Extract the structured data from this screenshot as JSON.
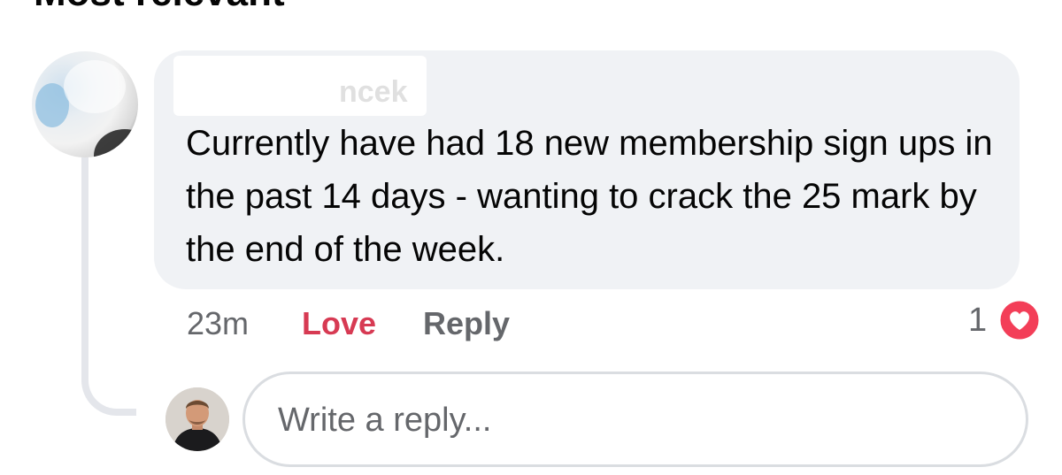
{
  "section": {
    "title": "Most relevant"
  },
  "comment": {
    "author_visible": "ncek",
    "text": "Currently have had 18 new membership sign ups in the past 14 days - wanting to crack the 25 mark by the end of the week.",
    "time": "23m",
    "love_label": "Love",
    "reply_label": "Reply",
    "reaction_count": "1",
    "reaction_icon": "heart-icon",
    "love_color": "#d73a53",
    "bubble_color": "#f0f2f5"
  },
  "reply_box": {
    "placeholder": "Write a reply..."
  }
}
